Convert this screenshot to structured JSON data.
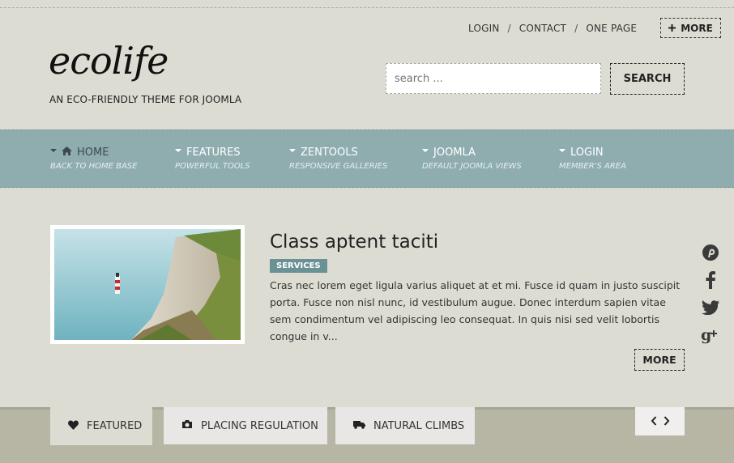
{
  "header": {
    "top_links": [
      "LOGIN",
      "CONTACT",
      "ONE PAGE"
    ],
    "link_separator": "/",
    "more_label": "MORE",
    "more_icon": "plus-icon",
    "logo": "ecolife",
    "tagline": "AN ECO-FRIENDLY THEME FOR JOOMLA"
  },
  "search": {
    "placeholder": "search ...",
    "button_label": "SEARCH"
  },
  "nav": {
    "items": [
      {
        "label": "HOME",
        "sub": "BACK TO HOME BASE",
        "icon": "home-icon",
        "active": true
      },
      {
        "label": "FEATURES",
        "sub": "POWERFUL TOOLS",
        "active": false
      },
      {
        "label": "ZENTOOLS",
        "sub": "RESPONSIVE GALLERIES",
        "active": false
      },
      {
        "label": "JOOMLA",
        "sub": "DEFAULT JOOMLA VIEWS",
        "active": false
      },
      {
        "label": "LOGIN",
        "sub": "MEMBER'S AREA",
        "active": false
      }
    ]
  },
  "article": {
    "title": "Class aptent taciti",
    "category": "SERVICES",
    "excerpt": "Cras nec lorem eget ligula varius aliquet at et mi. Fusce id quam in justo suscipit porta. Fusce non nisl nunc, id vestibulum augue. Donec interdum sapien vitae sem condimentum vel adipiscing leo consequat. In quis nisi sed velit lobortis congue in v...",
    "more_label": "MORE"
  },
  "social": [
    "pinterest-icon",
    "facebook-icon",
    "twitter-icon",
    "google-plus-icon"
  ],
  "tabs": [
    {
      "label": "FEATURED",
      "icon": "heart-icon",
      "active": true
    },
    {
      "label": "PLACING REGULATION",
      "icon": "camera-icon",
      "active": false
    },
    {
      "label": "NATURAL CLIMBS",
      "icon": "truck-icon",
      "active": false
    }
  ],
  "colors": {
    "background": "#dddcd2",
    "nav_bar": "#8fadaf",
    "badge": "#6a9193",
    "bottom_band": "#b7b5a3"
  }
}
